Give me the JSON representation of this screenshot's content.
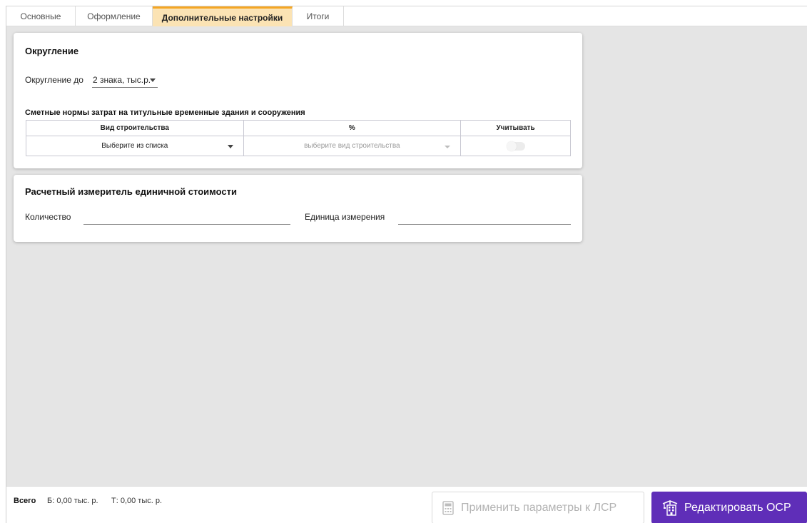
{
  "tabs": [
    {
      "label": "Основные",
      "active": false
    },
    {
      "label": "Оформление",
      "active": false
    },
    {
      "label": "Дополнительные настройки",
      "active": true
    },
    {
      "label": "Итоги",
      "active": false
    }
  ],
  "rounding": {
    "title": "Округление",
    "label": "Округление до",
    "value": "2 знака, тыс.р."
  },
  "norms": {
    "title": "Сметные нормы затрат на титульные временные здания и сооружения",
    "columns": [
      "Вид строительства",
      "%",
      "Учитывать"
    ],
    "row": {
      "type_value": "Выберите из списка",
      "percent_placeholder": "выберите вид строительства",
      "consider": false
    }
  },
  "unit_meter": {
    "title": "Расчетный измеритель единичной стоимости",
    "quantity_label": "Количество",
    "quantity_value": "",
    "unit_label": "Единица измерения",
    "unit_value": ""
  },
  "footer": {
    "total_label": "Всего",
    "total_b": "Б: 0,00 тыс. р.",
    "total_t": "Т: 0,00 тыс. р.",
    "apply_button": "Применить параметры к ЛСР",
    "edit_button": "Редактировать ОСР"
  },
  "colors": {
    "accent_tab": "#f5a623",
    "active_tab_bg": "#fbe3b4",
    "primary_button": "#5f2eb8",
    "background": "#e5e5e5"
  }
}
